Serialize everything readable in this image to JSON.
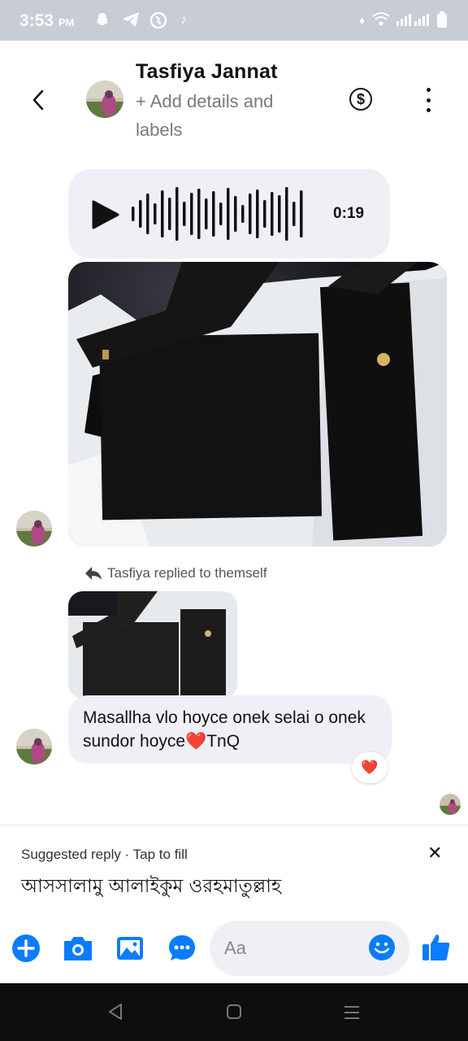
{
  "status_bar": {
    "time": "3:53",
    "ampm": "PM"
  },
  "header": {
    "name": "Tasfiya Jannat",
    "subtitle": "+ Add details and labels",
    "back_icon": "chevron-left-icon",
    "dollar_icon": "dollar-circle-icon",
    "more_icon": "more-vertical-icon"
  },
  "conversation": {
    "voice_message": {
      "duration": "0:19"
    },
    "reply_label": "Tasfiya replied to themself",
    "message_text": "Masallha vlo hoyce onek selai o onek sundor hoyce❤️TnQ",
    "reaction": "❤️"
  },
  "suggested_reply": {
    "title": "Suggested reply · Tap to fill",
    "text": "আসসালামু আলাইকুম ওরহমাতুল্লাহ"
  },
  "composer": {
    "placeholder": "Aa"
  },
  "colors": {
    "accent": "#0a7cff",
    "bubble": "#efeff6"
  }
}
